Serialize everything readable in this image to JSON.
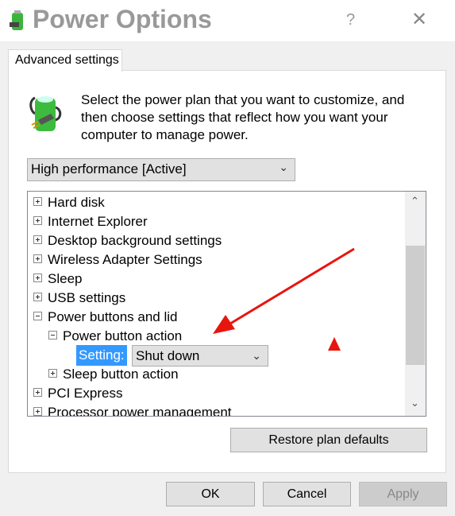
{
  "window": {
    "title": "Power Options",
    "help": "?",
    "close": "✕"
  },
  "tab": "Advanced settings",
  "description": "Select the power plan that you want to customize, and then choose settings that reflect how you want your computer to manage power.",
  "plan_select": {
    "value": "High performance [Active]"
  },
  "tree": {
    "items": [
      "Hard disk",
      "Internet Explorer",
      "Desktop background settings",
      "Wireless Adapter Settings",
      "Sleep",
      "USB settings",
      "Power buttons and lid",
      "Power button action",
      "Sleep button action",
      "PCI Express",
      "Processor power management"
    ],
    "setting_label": "Setting:",
    "setting_value": "Shut down"
  },
  "buttons": {
    "restore": "Restore plan defaults",
    "ok": "OK",
    "cancel": "Cancel",
    "apply": "Apply"
  },
  "colors": {
    "annotation": "#e8150f",
    "selection": "#3399ff"
  }
}
